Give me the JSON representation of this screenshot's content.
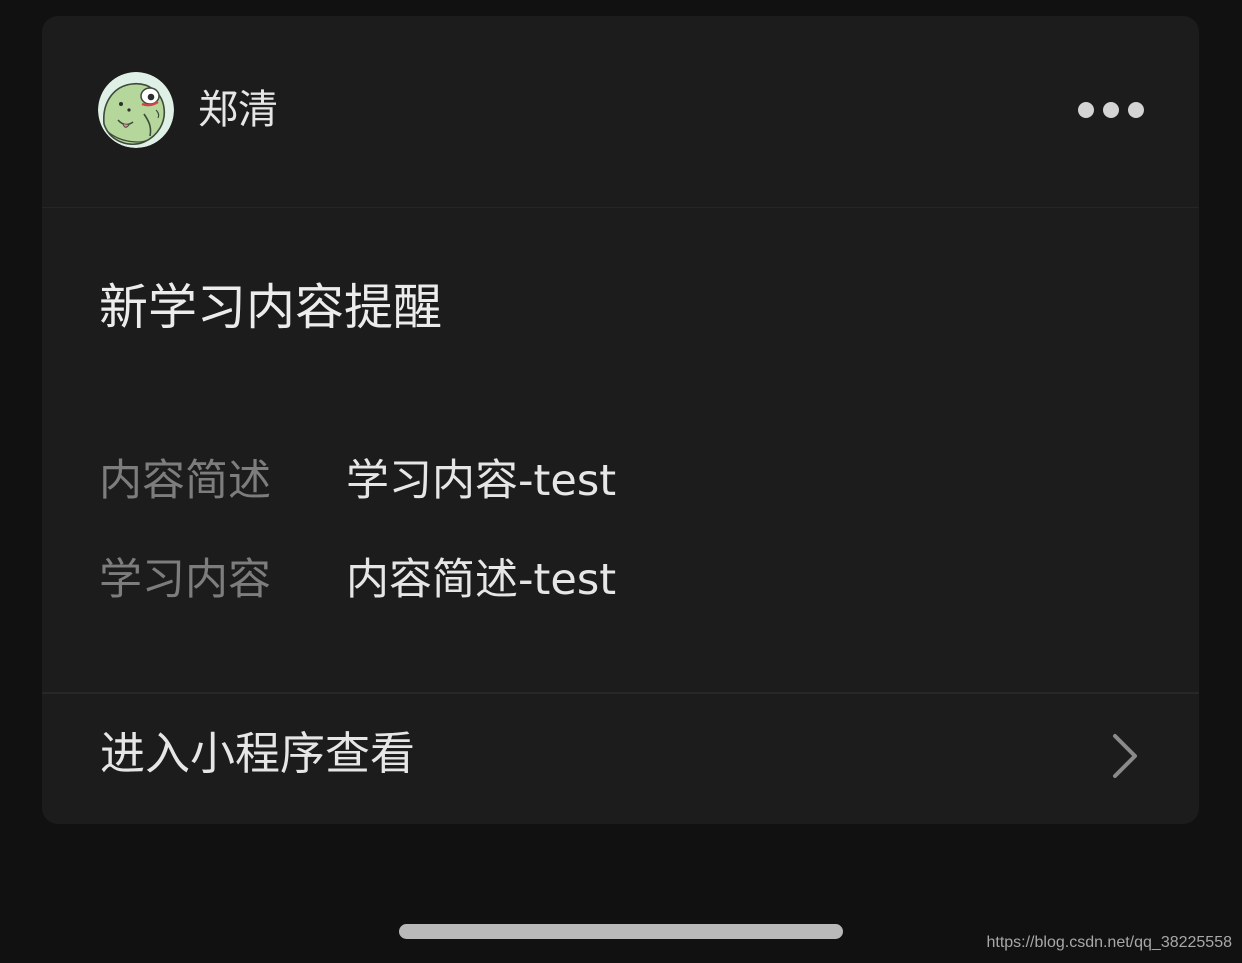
{
  "header": {
    "sender_name": "郑清",
    "avatar_icon": "frog-cartoon-avatar",
    "more_icon": "more-dots-icon"
  },
  "message": {
    "title": "新学习内容提醒",
    "fields": [
      {
        "label": "内容简述",
        "value": "学习内容-test"
      },
      {
        "label": "学习内容",
        "value": "内容简述-test"
      }
    ]
  },
  "footer": {
    "action_label": "进入小程序查看",
    "action_icon": "chevron-right-icon"
  },
  "watermark": "https://blog.csdn.net/qq_38225558",
  "colors": {
    "background": "#111111",
    "card": "#1c1c1c",
    "primary_text": "#e6e6e6",
    "secondary_text": "#7d7d7d",
    "divider": "#272727"
  }
}
